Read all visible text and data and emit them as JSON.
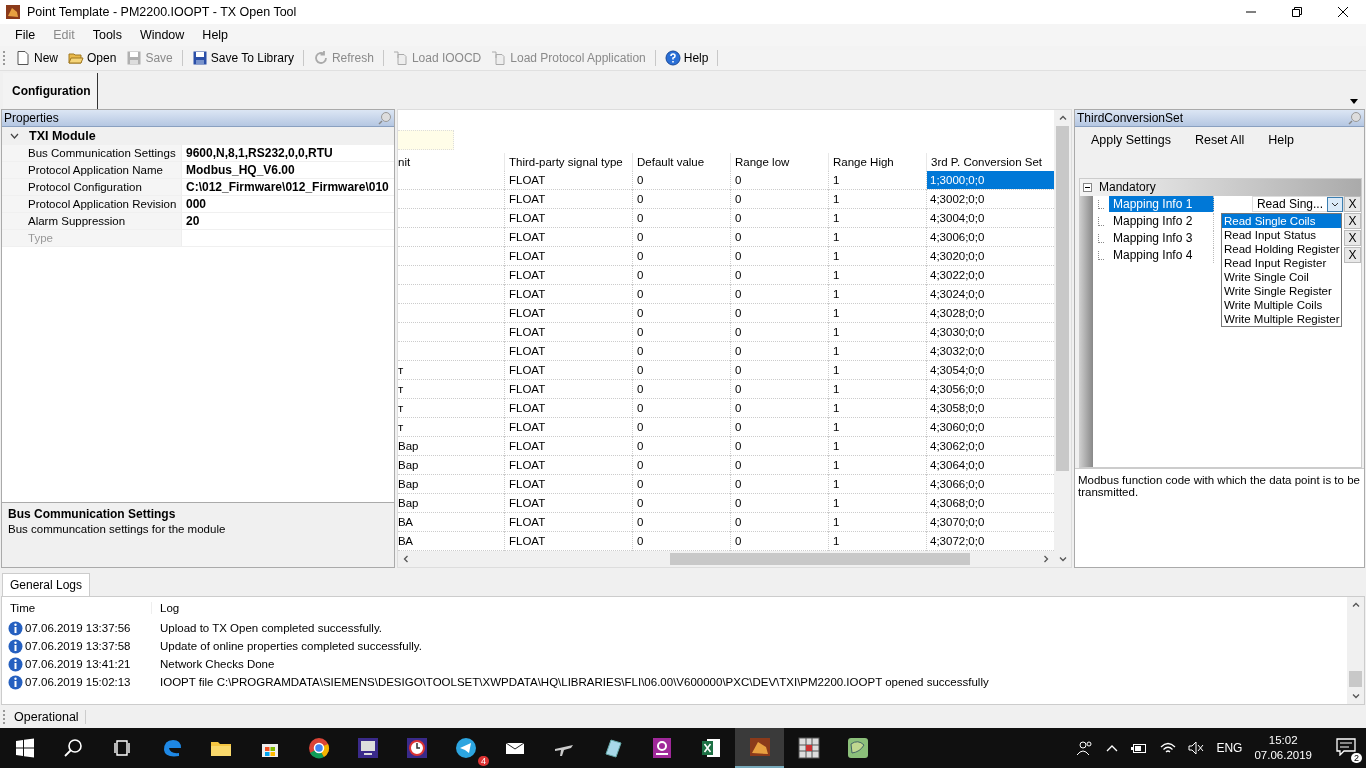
{
  "window": {
    "title": "Point Template - PM2200.IOOPT - TX Open Tool"
  },
  "menu": [
    {
      "label": "File",
      "disabled": false
    },
    {
      "label": "Edit",
      "disabled": true
    },
    {
      "label": "Tools",
      "disabled": false
    },
    {
      "label": "Window",
      "disabled": false
    },
    {
      "label": "Help",
      "disabled": false
    }
  ],
  "toolbar": [
    {
      "label": "New",
      "kind": "new",
      "disabled": false
    },
    {
      "label": "Open",
      "kind": "open",
      "disabled": false
    },
    {
      "label": "Save",
      "kind": "save",
      "disabled": true
    },
    {
      "label": "Save To Library",
      "kind": "save",
      "disabled": false
    },
    {
      "label": "Refresh",
      "kind": "refresh",
      "disabled": true
    },
    {
      "label": "Load IOOCD",
      "kind": "load",
      "disabled": true
    },
    {
      "label": "Load Protocol Application",
      "kind": "load",
      "disabled": true
    },
    {
      "label": "Help",
      "kind": "help",
      "disabled": false
    }
  ],
  "tabs": [
    {
      "label": "Configuration",
      "selected": true
    }
  ],
  "properties": {
    "title": "Properties",
    "category": "TXI Module",
    "expanded": true,
    "rows": [
      {
        "name": "Bus Communication Settings",
        "value": "9600,N,8,1,RS232,0,0,RTU",
        "disabled": false
      },
      {
        "name": "Protocol Application Name",
        "value": "Modbus_HQ_V6.00",
        "disabled": false
      },
      {
        "name": "Protocol Configuration",
        "value": "C:\\012_Firmware\\012_Firmware\\010",
        "disabled": false
      },
      {
        "name": "Protocol Application Revision",
        "value": "000",
        "disabled": false
      },
      {
        "name": "Alarm Suppression",
        "value": "20",
        "disabled": false
      },
      {
        "name": "Type",
        "value": "",
        "disabled": true
      }
    ],
    "description_title": "Bus Communication Settings",
    "description": "Bus communcation settings for the module"
  },
  "grid": {
    "columns": [
      "nit",
      "Third-party signal type",
      "Default value",
      "Range low",
      "Range High",
      "3rd P. Conversion Set"
    ],
    "rows": [
      {
        "cells": [
          "",
          "FLOAT",
          "0",
          "0",
          "1",
          "1;3000;0;0"
        ],
        "selected": true
      },
      {
        "cells": [
          "",
          "FLOAT",
          "0",
          "0",
          "1",
          "4;3002;0;0"
        ],
        "selected": false
      },
      {
        "cells": [
          "",
          "FLOAT",
          "0",
          "0",
          "1",
          "4;3004;0;0"
        ],
        "selected": false
      },
      {
        "cells": [
          "",
          "FLOAT",
          "0",
          "0",
          "1",
          "4;3006;0;0"
        ],
        "selected": false
      },
      {
        "cells": [
          "",
          "FLOAT",
          "0",
          "0",
          "1",
          "4;3020;0;0"
        ],
        "selected": false
      },
      {
        "cells": [
          "",
          "FLOAT",
          "0",
          "0",
          "1",
          "4;3022;0;0"
        ],
        "selected": false
      },
      {
        "cells": [
          "",
          "FLOAT",
          "0",
          "0",
          "1",
          "4;3024;0;0"
        ],
        "selected": false
      },
      {
        "cells": [
          "",
          "FLOAT",
          "0",
          "0",
          "1",
          "4;3028;0;0"
        ],
        "selected": false
      },
      {
        "cells": [
          "",
          "FLOAT",
          "0",
          "0",
          "1",
          "4;3030;0;0"
        ],
        "selected": false
      },
      {
        "cells": [
          "",
          "FLOAT",
          "0",
          "0",
          "1",
          "4;3032;0;0"
        ],
        "selected": false
      },
      {
        "cells": [
          "т",
          "FLOAT",
          "0",
          "0",
          "1",
          "4;3054;0;0"
        ],
        "selected": false
      },
      {
        "cells": [
          "т",
          "FLOAT",
          "0",
          "0",
          "1",
          "4;3056;0;0"
        ],
        "selected": false
      },
      {
        "cells": [
          "т",
          "FLOAT",
          "0",
          "0",
          "1",
          "4;3058;0;0"
        ],
        "selected": false
      },
      {
        "cells": [
          "т",
          "FLOAT",
          "0",
          "0",
          "1",
          "4;3060;0;0"
        ],
        "selected": false
      },
      {
        "cells": [
          "Вар",
          "FLOAT",
          "0",
          "0",
          "1",
          "4;3062;0;0"
        ],
        "selected": false
      },
      {
        "cells": [
          "Вар",
          "FLOAT",
          "0",
          "0",
          "1",
          "4;3064;0;0"
        ],
        "selected": false
      },
      {
        "cells": [
          "Вар",
          "FLOAT",
          "0",
          "0",
          "1",
          "4;3066;0;0"
        ],
        "selected": false
      },
      {
        "cells": [
          "Вар",
          "FLOAT",
          "0",
          "0",
          "1",
          "4;3068;0;0"
        ],
        "selected": false
      },
      {
        "cells": [
          "ВА",
          "FLOAT",
          "0",
          "0",
          "1",
          "4;3070;0;0"
        ],
        "selected": false
      },
      {
        "cells": [
          "ВА",
          "FLOAT",
          "0",
          "0",
          "1",
          "4;3072;0;0"
        ],
        "selected": false
      }
    ]
  },
  "conversion_panel": {
    "title": "ThirdConversionSet",
    "actions": [
      "Apply Settings",
      "Reset All",
      "Help"
    ],
    "category": "Mandatory",
    "expanded": true,
    "items": [
      {
        "label": "Mapping Info 1",
        "selected": true,
        "clear": "X"
      },
      {
        "label": "Mapping Info 2",
        "selected": false,
        "clear": "X"
      },
      {
        "label": "Mapping Info 3",
        "selected": false,
        "clear": "X"
      },
      {
        "label": "Mapping Info 4",
        "selected": false,
        "clear": "X"
      }
    ],
    "editor_value": "Read  Sing...",
    "dropdown": [
      {
        "label": "Read Single Coils",
        "selected": true
      },
      {
        "label": "Read Input Status",
        "selected": false
      },
      {
        "label": "Read Holding Register",
        "selected": false
      },
      {
        "label": "Read Input Register",
        "selected": false
      },
      {
        "label": "Write Single Coil",
        "selected": false
      },
      {
        "label": "Write Single Register",
        "selected": false
      },
      {
        "label": "Write Multiple Coils",
        "selected": false
      },
      {
        "label": "Write Multiple Register",
        "selected": false
      }
    ],
    "description": "Modbus function code with which the data point is to be transmitted."
  },
  "logs": {
    "tab": "General Logs",
    "columns": [
      "Time",
      "Log"
    ],
    "rows": [
      {
        "time": "07.06.2019 13:37:56",
        "message": "Upload to TX Open completed successfully."
      },
      {
        "time": "07.06.2019 13:37:58",
        "message": "Update of online properties completed successfully."
      },
      {
        "time": "07.06.2019 13:41:21",
        "message": "Network Checks Done"
      },
      {
        "time": "07.06.2019 15:02:13",
        "message": "IOOPT file C:\\PROGRAMDATA\\SIEMENS\\DESIGO\\TOOLSET\\XWPDATA\\HQ\\LIBRARIES\\FLI\\06.00\\V600000\\PXC\\DEV\\TXI\\PM2200.IOOPT opened successfully"
      }
    ]
  },
  "status_bar": "Operational",
  "taskbar": {
    "apps": [
      {
        "kind": "start",
        "active": false
      },
      {
        "kind": "search",
        "active": false
      },
      {
        "kind": "taskview",
        "active": false
      },
      {
        "kind": "edge",
        "active": false
      },
      {
        "kind": "folder",
        "active": false
      },
      {
        "kind": "store",
        "active": false
      },
      {
        "kind": "chrome",
        "active": false
      },
      {
        "kind": "monitor",
        "active": false
      },
      {
        "kind": "clock",
        "active": false
      },
      {
        "kind": "telegram",
        "active": false,
        "badge": "4"
      },
      {
        "kind": "mail",
        "active": false
      },
      {
        "kind": "plane",
        "active": false
      },
      {
        "kind": "paper",
        "active": false
      },
      {
        "kind": "pdf",
        "active": false
      },
      {
        "kind": "excel",
        "active": false
      },
      {
        "kind": "tool",
        "active": true
      },
      {
        "kind": "grid",
        "active": false
      },
      {
        "kind": "map",
        "active": false
      }
    ],
    "language": "ENG",
    "time": "15:02",
    "date": "07.06.2019",
    "notifications": "2"
  }
}
